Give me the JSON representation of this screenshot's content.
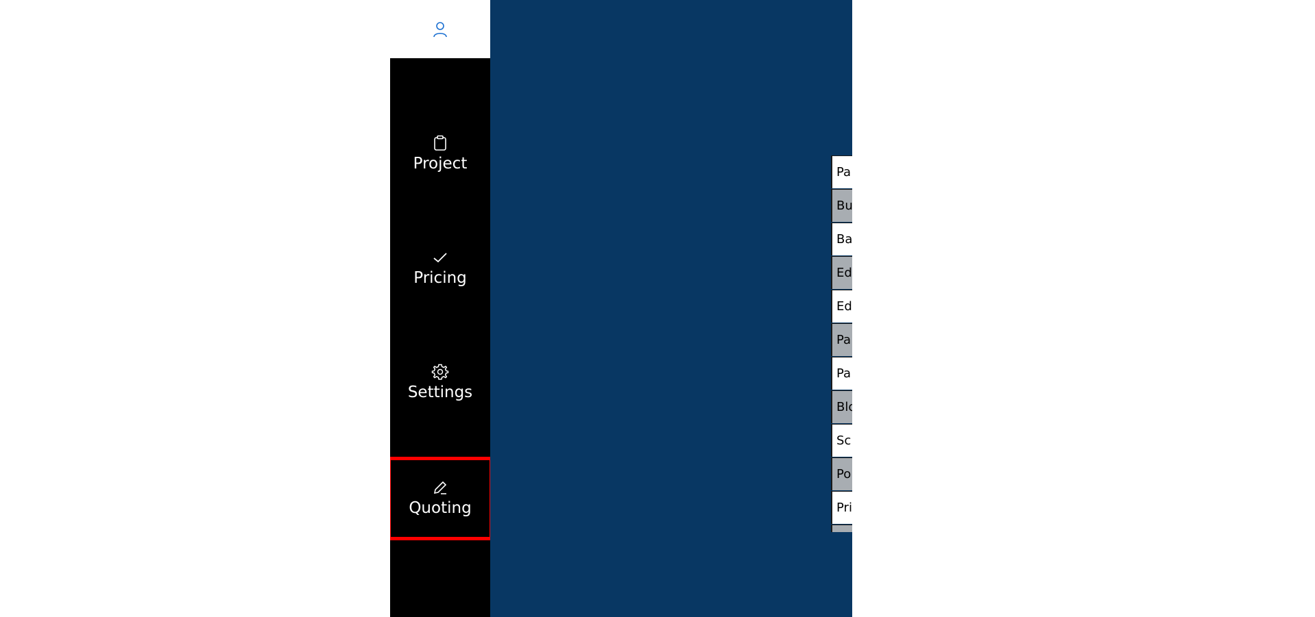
{
  "sidebar": {
    "profile_icon": "user-icon",
    "items": [
      {
        "label": "Project",
        "icon": "clipboard-icon"
      },
      {
        "label": "Pricing",
        "icon": "checkmark-icon"
      },
      {
        "label": "Settings",
        "icon": "gear-icon"
      },
      {
        "label": "Quoting",
        "icon": "pencil-icon",
        "highlighted": true
      }
    ]
  },
  "list": {
    "rows": [
      "Pa",
      "Bu",
      "Ba",
      "Ed",
      "Ed",
      "Pa",
      "Pa",
      "Blo",
      "Sc",
      "Po",
      "Pri",
      ""
    ]
  },
  "colors": {
    "sidebar_bg": "#000000",
    "main_bg": "#083763",
    "profile_icon": "#1a6fd1",
    "highlight": "#ff0000",
    "row_alt": "#a8adb2"
  }
}
